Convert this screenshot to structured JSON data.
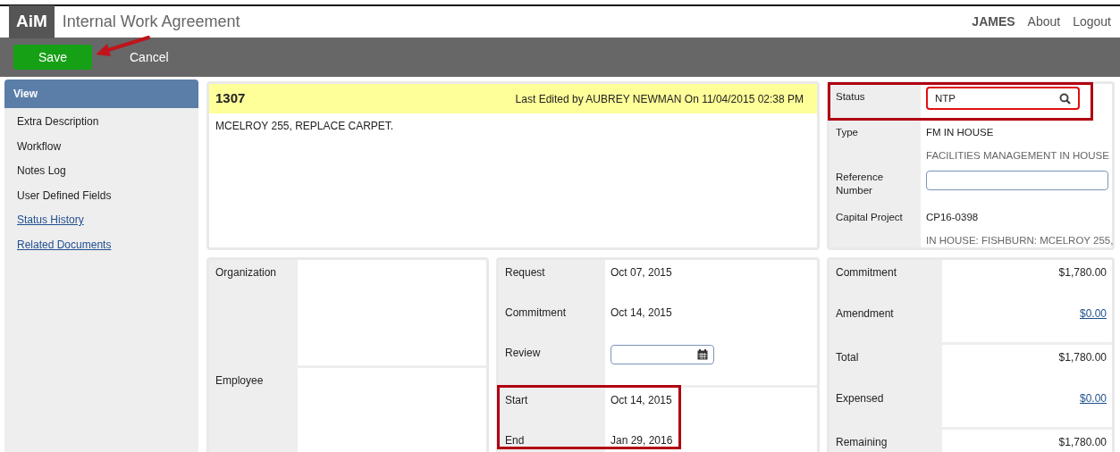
{
  "header": {
    "logo": "AiM",
    "title": "Internal Work Agreement",
    "user": "JAMES",
    "links": [
      "About",
      "Logout"
    ]
  },
  "toolbar": [
    {
      "label": "Save",
      "kind": "primary"
    },
    {
      "label": "Cancel",
      "kind": "plain"
    }
  ],
  "sidebar": {
    "header": "View",
    "items": [
      {
        "label": "Extra Description",
        "kind": "plain"
      },
      {
        "label": "Workflow",
        "kind": "plain"
      },
      {
        "label": "Notes Log",
        "kind": "plain"
      },
      {
        "label": "User Defined Fields",
        "kind": "plain"
      },
      {
        "label": "Status History",
        "kind": "link"
      },
      {
        "label": "Related Documents",
        "kind": "link"
      }
    ]
  },
  "record": {
    "number": "1307",
    "last_edited": "Last Edited by AUBREY NEWMAN On 11/04/2015 02:38 PM",
    "description": "MCELROY 255, REPLACE CARPET."
  },
  "details": [
    {
      "label": "Status",
      "kind": "search",
      "value": "NTP",
      "highlighted": true
    },
    {
      "label": "Type",
      "kind": "text",
      "value": "FM IN HOUSE",
      "note": "FACILITIES MANAGEMENT IN HOUSE",
      "highlighted": false
    },
    {
      "label": "Reference Number",
      "kind": "input",
      "highlighted": false
    },
    {
      "label": "Capital Project",
      "kind": "text",
      "value": "CP16-0398",
      "note": "IN HOUSE: FISHBURN: MCELROY 255,",
      "highlighted": false
    }
  ],
  "people": [
    {
      "label": "Organization"
    },
    {
      "label": "Employee"
    }
  ],
  "dates": [
    {
      "highlighted": false,
      "rows": [
        {
          "label": "Request",
          "kind": "text",
          "value": "Oct 07, 2015"
        },
        {
          "label": "Commitment",
          "kind": "text",
          "value": "Oct 14, 2015"
        },
        {
          "label": "Review",
          "kind": "date-input"
        }
      ]
    },
    {
      "highlighted": true,
      "rows": [
        {
          "label": "Start",
          "kind": "text",
          "value": "Oct 14, 2015"
        },
        {
          "label": "End",
          "kind": "text",
          "value": "Jan 29, 2016"
        }
      ]
    }
  ],
  "amounts": [
    {
      "rows": [
        {
          "label": "Commitment",
          "kind": "text",
          "value": "$1,780.00"
        },
        {
          "label": "Amendment",
          "kind": "link",
          "value": "$0.00"
        }
      ]
    },
    {
      "rows": [
        {
          "label": "Total",
          "kind": "text",
          "value": "$1,780.00"
        },
        {
          "label": "Expensed",
          "kind": "link",
          "value": "$0.00"
        }
      ]
    },
    {
      "rows": [
        {
          "label": "Remaining",
          "kind": "text",
          "value": "$1,780.00"
        }
      ]
    }
  ]
}
